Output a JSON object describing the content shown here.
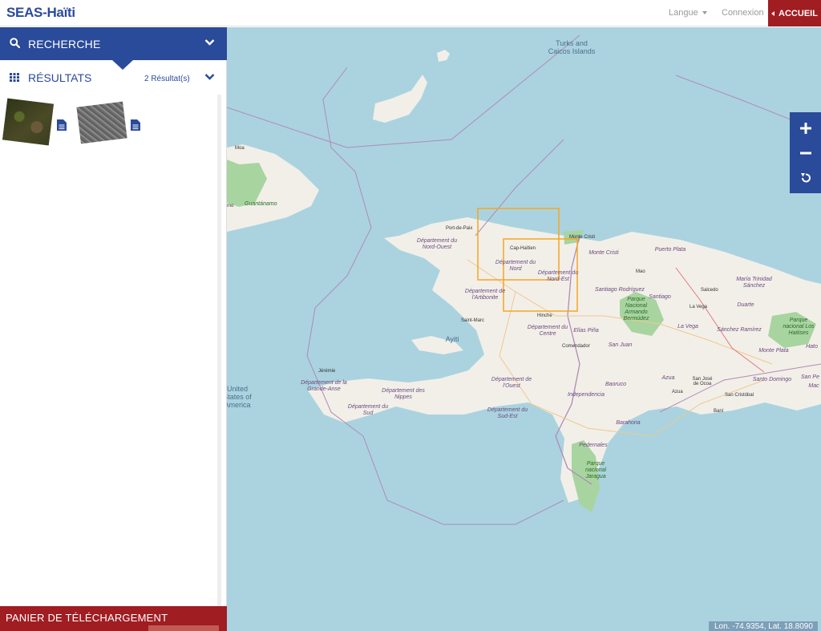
{
  "topbar": {
    "brand": "SEAS-Haïti",
    "language_label": "Langue",
    "login_label": "Connexion",
    "home_label": "ACCUEIL"
  },
  "sidebar": {
    "search_label": "RECHERCHE",
    "results_label": "RÉSULTATS",
    "results_count": "2 Résultat(s)",
    "cart_label": "PANIER DE TÉLÉCHARGEMENT"
  },
  "map": {
    "coords": "Lon. -74.9354, Lat. 18.8090",
    "labels": {
      "turks": "Turks and Caicos Islands",
      "moa": "Moa",
      "guantanamo": "Guantánamo",
      "no": "mo",
      "port_de_paix": "Port-de-Paix",
      "nord_ouest": "Département du Nord-Ouest",
      "cap_haitien": "Cap-Haïtien",
      "nord": "Département du Nord",
      "nord_est": "Département du Nord-Est",
      "monte_cristi_town": "Monte Cristi",
      "monte_cristi": "Monte Cristi",
      "puerto_plata": "Puerto Plata",
      "mao": "Mao",
      "artibonite": "Département de l'Artibonite",
      "santiago_rodriguez": "Santiago Rodríguez",
      "santiago": "Santiago",
      "parque_armando": "Parque Nacional Armando Bermúdez",
      "salcedo": "Salcedo",
      "maria_trinidad": "María Trinidad Sánchez",
      "la_vega_town": "La Vega",
      "duarte": "Duarte",
      "saint_marc": "Saint-Marc",
      "hinche": "Hinche",
      "ayiti": "Ayiti",
      "centre": "Département du Centre",
      "elias_pina": "Elías Piña",
      "la_vega": "La Vega",
      "sanchez_ramirez": "Sánchez Ramírez",
      "parque_haitises": "Parque nacional Los Haitises",
      "hato": "Hato",
      "comendador": "Comendador",
      "san_juan": "San Juan",
      "monte_plata": "Monte Plata",
      "jeremie": "Jérémie",
      "grande_anse": "Département de la Grande-Anse",
      "nippes": "Département des Nippes",
      "ouest": "Département de l'Ouest",
      "azua_town": "Azua",
      "san_jose": "San José de Ocoa",
      "azua": "Azua",
      "santo_domingo": "Santo Domingo",
      "san_pe": "San Pe",
      "mac": "Mac",
      "sud": "Département du Sud",
      "sud_est": "Département du Sud-Est",
      "independencia": "Independencia",
      "baoruco": "Baoruco",
      "san_cristobal": "San Cristóbal",
      "bani": "Baní",
      "barahona": "Barahona",
      "united_states": "United States of America",
      "pedernales": "Pedernales",
      "parque_jaragua": "Parque nacional Jaragua"
    }
  },
  "colors": {
    "brand_blue": "#2a4a9a",
    "accent_red": "#a01d22",
    "sea": "#aad3df",
    "land": "#f2efe9",
    "footprint": "#f5a623"
  }
}
